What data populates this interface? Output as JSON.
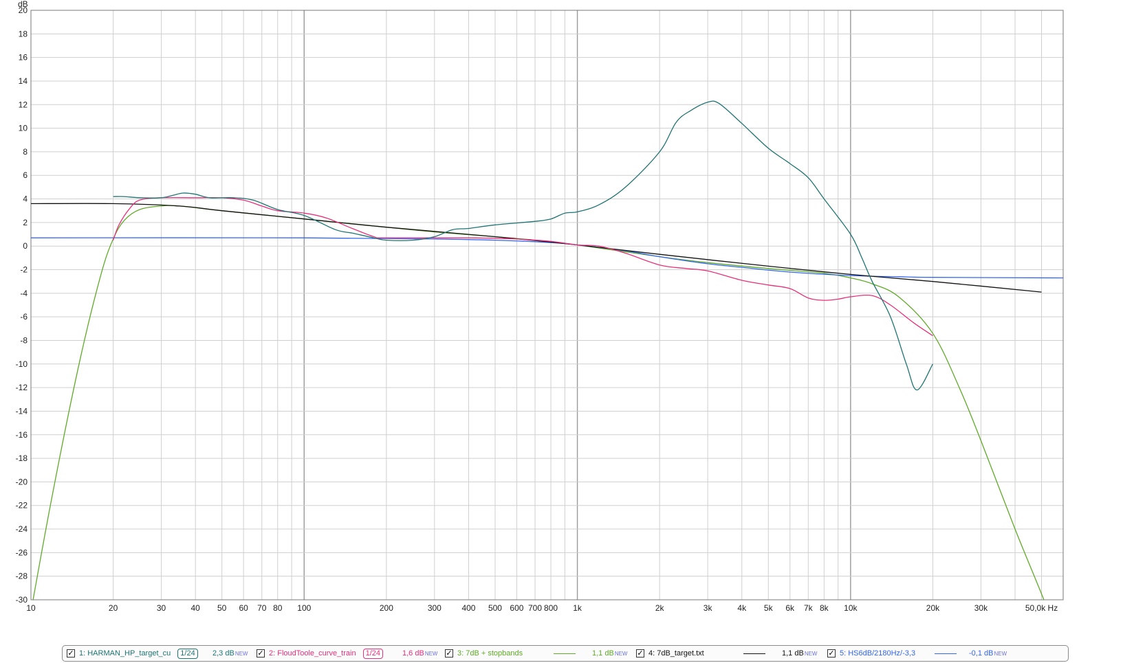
{
  "chart_data": {
    "type": "line",
    "xscale": "log",
    "xlim": [
      10,
      60000
    ],
    "ylim": [
      -30,
      20
    ],
    "yticks": [
      20,
      18,
      16,
      14,
      12,
      10,
      8,
      6,
      4,
      2,
      0,
      -2,
      -4,
      -6,
      -8,
      -10,
      -12,
      -14,
      -16,
      -18,
      -20,
      -22,
      -24,
      -26,
      -28,
      -30
    ],
    "xticks": [
      {
        "value": 10,
        "label": "10"
      },
      {
        "value": 20,
        "label": "20"
      },
      {
        "value": 30,
        "label": "30"
      },
      {
        "value": 40,
        "label": "40"
      },
      {
        "value": 50,
        "label": "50"
      },
      {
        "value": 60,
        "label": "60"
      },
      {
        "value": 70,
        "label": "70"
      },
      {
        "value": 80,
        "label": "80"
      },
      {
        "value": 100,
        "label": "100"
      },
      {
        "value": 200,
        "label": "200"
      },
      {
        "value": 300,
        "label": "300"
      },
      {
        "value": 400,
        "label": "400"
      },
      {
        "value": 500,
        "label": "500"
      },
      {
        "value": 600,
        "label": "600"
      },
      {
        "value": 700,
        "label": "700"
      },
      {
        "value": 800,
        "label": "800"
      },
      {
        "value": 1000,
        "label": "1k"
      },
      {
        "value": 2000,
        "label": "2k"
      },
      {
        "value": 3000,
        "label": "3k"
      },
      {
        "value": 4000,
        "label": "4k"
      },
      {
        "value": 5000,
        "label": "5k"
      },
      {
        "value": 6000,
        "label": "6k"
      },
      {
        "value": 7000,
        "label": "7k"
      },
      {
        "value": 8000,
        "label": "8k"
      },
      {
        "value": 10000,
        "label": "10k"
      },
      {
        "value": 20000,
        "label": "20k"
      },
      {
        "value": 30000,
        "label": "30k"
      },
      {
        "value": 50000,
        "label": "50,0k Hz"
      }
    ],
    "ylabel": "dB",
    "grid": true,
    "series": [
      {
        "name": "1: HARMAN_HP_target_cu",
        "color": "#1e7373",
        "points": [
          [
            20,
            4.2
          ],
          [
            22,
            4.2
          ],
          [
            25,
            4.1
          ],
          [
            30,
            4.1
          ],
          [
            33,
            4.3
          ],
          [
            36,
            4.5
          ],
          [
            40,
            4.4
          ],
          [
            45,
            4.1
          ],
          [
            55,
            4.1
          ],
          [
            65,
            3.9
          ],
          [
            80,
            3.1
          ],
          [
            100,
            2.6
          ],
          [
            130,
            1.4
          ],
          [
            150,
            1.1
          ],
          [
            180,
            0.7
          ],
          [
            200,
            0.5
          ],
          [
            250,
            0.5
          ],
          [
            300,
            0.8
          ],
          [
            350,
            1.4
          ],
          [
            400,
            1.5
          ],
          [
            500,
            1.8
          ],
          [
            700,
            2.1
          ],
          [
            800,
            2.3
          ],
          [
            900,
            2.8
          ],
          [
            1000,
            2.9
          ],
          [
            1200,
            3.5
          ],
          [
            1500,
            5
          ],
          [
            2000,
            8
          ],
          [
            2300,
            10.5
          ],
          [
            2600,
            11.5
          ],
          [
            3000,
            12.2
          ],
          [
            3300,
            12.1
          ],
          [
            4000,
            10.4
          ],
          [
            5000,
            8.3
          ],
          [
            6000,
            7
          ],
          [
            7000,
            5.8
          ],
          [
            8000,
            4
          ],
          [
            10000,
            1
          ],
          [
            11000,
            -1
          ],
          [
            12000,
            -3
          ],
          [
            14000,
            -6
          ],
          [
            16000,
            -10
          ],
          [
            17500,
            -12.2
          ],
          [
            20000,
            -10
          ]
        ]
      },
      {
        "name": "2: FloudToole_curve_train",
        "color": "#e5307b",
        "points": [
          [
            20,
            0.5
          ],
          [
            21,
            1.8
          ],
          [
            23,
            3.2
          ],
          [
            25,
            3.9
          ],
          [
            30,
            4.1
          ],
          [
            40,
            4.1
          ],
          [
            50,
            4.1
          ],
          [
            60,
            3.9
          ],
          [
            70,
            3.4
          ],
          [
            80,
            3.0
          ],
          [
            100,
            2.8
          ],
          [
            120,
            2.4
          ],
          [
            150,
            1.5
          ],
          [
            180,
            0.8
          ],
          [
            200,
            0.7
          ],
          [
            400,
            0.7
          ],
          [
            600,
            0.6
          ],
          [
            800,
            0.4
          ],
          [
            1000,
            0.1
          ],
          [
            1200,
            0
          ],
          [
            1500,
            -0.6
          ],
          [
            2000,
            -1.6
          ],
          [
            2500,
            -1.9
          ],
          [
            3000,
            -2.1
          ],
          [
            4000,
            -2.9
          ],
          [
            5000,
            -3.3
          ],
          [
            6000,
            -3.6
          ],
          [
            7000,
            -4.4
          ],
          [
            8000,
            -4.6
          ],
          [
            9000,
            -4.5
          ],
          [
            10000,
            -4.3
          ],
          [
            12000,
            -4.2
          ],
          [
            14000,
            -5
          ],
          [
            17000,
            -6.5
          ],
          [
            20000,
            -7.6
          ]
        ]
      },
      {
        "name": "3: 7dB + stopbands",
        "color": "#5faa28",
        "points": [
          [
            10,
            -31
          ],
          [
            12,
            -21
          ],
          [
            15,
            -10
          ],
          [
            18,
            -2.5
          ],
          [
            20,
            0.6
          ],
          [
            22,
            2.2
          ],
          [
            25,
            3.1
          ],
          [
            30,
            3.4
          ],
          [
            35,
            3.4
          ],
          [
            50,
            3.0
          ],
          [
            100,
            2.3
          ],
          [
            200,
            1.6
          ],
          [
            300,
            1.2
          ],
          [
            500,
            0.8
          ],
          [
            700,
            0.5
          ],
          [
            1000,
            0.1
          ],
          [
            2000,
            -0.9
          ],
          [
            3000,
            -1.4
          ],
          [
            5000,
            -1.9
          ],
          [
            8000,
            -2.3
          ],
          [
            10000,
            -2.7
          ],
          [
            12000,
            -3.2
          ],
          [
            15000,
            -4.3
          ],
          [
            20000,
            -7.4
          ],
          [
            25000,
            -12
          ],
          [
            30000,
            -16.5
          ],
          [
            40000,
            -24
          ],
          [
            50000,
            -29.5
          ],
          [
            55000,
            -32
          ]
        ]
      },
      {
        "name": "4: 7dB_target.txt",
        "color": "#111111",
        "points": [
          [
            10,
            3.6
          ],
          [
            20,
            3.6
          ],
          [
            35,
            3.4
          ],
          [
            50,
            3.0
          ],
          [
            100,
            2.3
          ],
          [
            200,
            1.6
          ],
          [
            500,
            0.8
          ],
          [
            1000,
            0.1
          ],
          [
            2000,
            -0.7
          ],
          [
            5000,
            -1.7
          ],
          [
            10000,
            -2.4
          ],
          [
            20000,
            -3.0
          ],
          [
            50000,
            -3.9
          ]
        ]
      },
      {
        "name": "5: HS6dB/2180Hz/-3,3",
        "color": "#3366ee",
        "points": [
          [
            10,
            0.7
          ],
          [
            100,
            0.7
          ],
          [
            300,
            0.6
          ],
          [
            500,
            0.5
          ],
          [
            800,
            0.3
          ],
          [
            1000,
            0.1
          ],
          [
            1500,
            -0.4
          ],
          [
            2000,
            -0.9
          ],
          [
            3000,
            -1.5
          ],
          [
            4000,
            -1.8
          ],
          [
            6000,
            -2.2
          ],
          [
            10000,
            -2.5
          ],
          [
            15000,
            -2.6
          ],
          [
            20000,
            -2.65
          ],
          [
            60000,
            -2.7
          ]
        ]
      }
    ]
  },
  "legend": {
    "entries": [
      {
        "name": "1: HARMAN_HP_target_cu",
        "value": "2,3 dB",
        "smoothing": "1/24",
        "color": "#1e7373",
        "checked": true
      },
      {
        "name": "2: FloudToole_curve_train",
        "value": "1,6 dB",
        "smoothing": "1/24",
        "color": "#e5307b",
        "checked": true
      },
      {
        "name": "3: 7dB + stopbands",
        "value": "1,1 dB",
        "smoothing": "",
        "color": "#5faa28",
        "checked": true
      },
      {
        "name": "4: 7dB_target.txt",
        "value": "1,1 dB",
        "smoothing": "",
        "color": "#111111",
        "checked": true
      },
      {
        "name": "5: HS6dB/2180Hz/-3,3",
        "value": "-0,1 dB",
        "smoothing": "",
        "color": "#3366ee",
        "checked": true
      }
    ],
    "new_badge": "NEW",
    "check_glyph": "✓"
  }
}
